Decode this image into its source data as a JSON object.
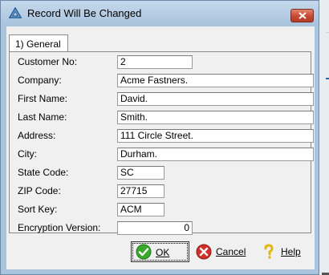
{
  "window": {
    "title": "Record Will Be Changed"
  },
  "tabs": [
    {
      "label": "1) General"
    }
  ],
  "fields": [
    {
      "label": "Customer No:",
      "value": "2"
    },
    {
      "label": "Company:",
      "value": "Acme Fastners."
    },
    {
      "label": "First Name:",
      "value": "David."
    },
    {
      "label": "Last Name:",
      "value": "Smith."
    },
    {
      "label": "Address:",
      "value": "111 Circle Street."
    },
    {
      "label": "City:",
      "value": "Durham."
    },
    {
      "label": "State Code:",
      "value": "SC"
    },
    {
      "label": "ZIP Code:",
      "value": "27715"
    },
    {
      "label": "Sort Key:",
      "value": "ACM"
    },
    {
      "label": "Encryption Version:",
      "value": "0"
    }
  ],
  "buttons": {
    "ok": "OK",
    "cancel": "Cancel",
    "help": "Help"
  },
  "colors": {
    "title_bg": "#b9cfe6",
    "close_btn": "#c44a33",
    "ok_icon": "#3aa82c",
    "cancel_icon": "#d0302a",
    "help_icon": "#f2d21a"
  },
  "icons": {
    "app": "app-triangle-icon",
    "close": "close-icon",
    "ok": "check-icon",
    "cancel": "cancel-x-icon",
    "help": "question-icon"
  }
}
